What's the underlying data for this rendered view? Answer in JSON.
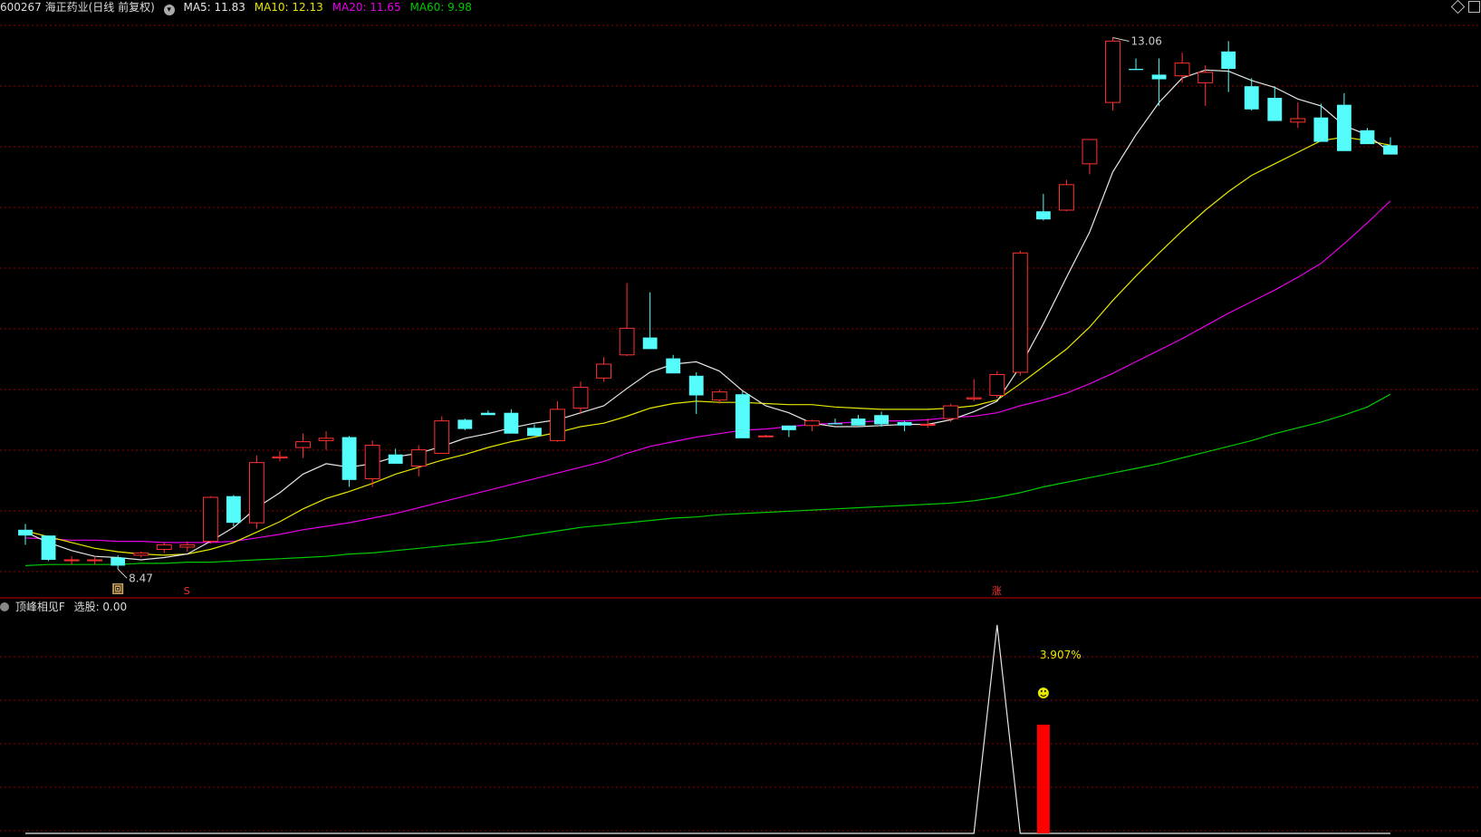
{
  "header": {
    "stock": "600267 海正药业(日线 前复权)",
    "ma5": "MA5: 11.83",
    "ma10": "MA10: 12.13",
    "ma20": "MA20: 11.65",
    "ma60": "MA60: 9.98"
  },
  "indicator": {
    "name": "顶峰相见F",
    "label": "选股: 0.00",
    "percent_label": "3.907%",
    "signal_icon": "smiley-icon"
  },
  "markers": {
    "high_label": "13.06",
    "low_label": "8.47",
    "signal_hui": "回",
    "signal_s": "S",
    "signal_zhang": "涨"
  },
  "colors": {
    "up": "#ff3232",
    "down": "#54fcfc",
    "ma5": "#e6e6e6",
    "ma10": "#e6e600",
    "ma20": "#e600e6",
    "ma60": "#00c800",
    "grid": "#8b0000"
  },
  "chart_data": {
    "type": "candlestick",
    "ohlc": [
      [
        8.81,
        8.86,
        8.68,
        8.76
      ],
      [
        8.76,
        8.73,
        8.54,
        8.55
      ],
      [
        8.55,
        8.58,
        8.51,
        8.55
      ],
      [
        8.55,
        8.58,
        8.51,
        8.55
      ],
      [
        8.57,
        8.59,
        8.47,
        8.5
      ],
      [
        8.59,
        8.62,
        8.57,
        8.61
      ],
      [
        8.64,
        8.7,
        8.61,
        8.68
      ],
      [
        8.66,
        8.71,
        8.62,
        8.68
      ],
      [
        8.71,
        9.1,
        8.69,
        9.09
      ],
      [
        9.1,
        9.11,
        8.84,
        8.87
      ],
      [
        8.87,
        9.45,
        8.82,
        9.39
      ],
      [
        9.43,
        9.49,
        9.4,
        9.44
      ],
      [
        9.52,
        9.64,
        9.43,
        9.57
      ],
      [
        9.58,
        9.66,
        9.5,
        9.6
      ],
      [
        9.61,
        9.62,
        9.18,
        9.24
      ],
      [
        9.25,
        9.58,
        9.18,
        9.54
      ],
      [
        9.46,
        9.51,
        9.45,
        9.38
      ],
      [
        9.36,
        9.54,
        9.27,
        9.5
      ],
      [
        9.47,
        9.79,
        9.47,
        9.75
      ],
      [
        9.76,
        9.77,
        9.67,
        9.68
      ],
      [
        9.82,
        9.84,
        9.81,
        9.8
      ],
      [
        9.82,
        9.85,
        9.79,
        9.64
      ],
      [
        9.69,
        9.72,
        9.64,
        9.62
      ],
      [
        9.58,
        9.92,
        9.57,
        9.85
      ],
      [
        9.86,
        10.09,
        9.81,
        10.04
      ],
      [
        10.12,
        10.3,
        10.09,
        10.24
      ],
      [
        10.32,
        10.94,
        10.31,
        10.55
      ],
      [
        10.47,
        10.86,
        10.38,
        10.37
      ],
      [
        10.29,
        10.32,
        10.24,
        10.16
      ],
      [
        10.14,
        10.17,
        9.81,
        9.97
      ],
      [
        9.93,
        10.02,
        9.9,
        10.0
      ],
      [
        9.98,
        10.01,
        9.63,
        9.6
      ],
      [
        9.62,
        9.63,
        9.61,
        9.62
      ],
      [
        9.71,
        9.71,
        9.61,
        9.67
      ],
      [
        9.71,
        9.76,
        9.66,
        9.75
      ],
      [
        9.73,
        9.77,
        9.72,
        9.72
      ],
      [
        9.77,
        9.8,
        9.71,
        9.71
      ],
      [
        9.8,
        9.83,
        9.7,
        9.72
      ],
      [
        9.74,
        9.75,
        9.66,
        9.71
      ],
      [
        9.72,
        9.77,
        9.69,
        9.72
      ],
      [
        9.77,
        9.9,
        9.74,
        9.88
      ],
      [
        9.94,
        10.11,
        9.92,
        9.95
      ],
      [
        9.97,
        10.18,
        9.95,
        10.15
      ],
      [
        10.17,
        11.22,
        10.14,
        11.2
      ],
      [
        11.56,
        11.71,
        11.48,
        11.49
      ],
      [
        11.57,
        11.83,
        11.56,
        11.79
      ],
      [
        11.97,
        12.18,
        11.88,
        12.18
      ],
      [
        12.5,
        13.06,
        12.43,
        13.03
      ],
      [
        12.79,
        12.88,
        12.78,
        12.78
      ],
      [
        12.74,
        12.88,
        12.47,
        12.7
      ],
      [
        12.73,
        12.93,
        12.67,
        12.84
      ],
      [
        12.67,
        12.82,
        12.47,
        12.76
      ],
      [
        12.94,
        13.03,
        12.59,
        12.79
      ],
      [
        12.64,
        12.71,
        12.43,
        12.44
      ],
      [
        12.54,
        12.64,
        12.37,
        12.34
      ],
      [
        12.33,
        12.5,
        12.28,
        12.36
      ],
      [
        12.37,
        12.49,
        12.16,
        12.16
      ],
      [
        12.48,
        12.58,
        12.2,
        12.08
      ],
      [
        12.26,
        12.28,
        12.14,
        12.14
      ],
      [
        12.13,
        12.2,
        12.07,
        12.05
      ]
    ],
    "ma5": [
      8.79,
      8.7,
      8.63,
      8.58,
      8.57,
      8.55,
      8.57,
      8.6,
      8.71,
      8.83,
      9.0,
      9.13,
      9.29,
      9.38,
      9.35,
      9.38,
      9.44,
      9.47,
      9.53,
      9.6,
      9.64,
      9.69,
      9.73,
      9.76,
      9.82,
      9.88,
      10.03,
      10.17,
      10.24,
      10.26,
      10.18,
      10.01,
      9.88,
      9.82,
      9.73,
      9.7,
      9.7,
      9.71,
      9.72,
      9.72,
      9.76,
      9.83,
      9.92,
      10.22,
      10.59,
      10.99,
      11.38,
      11.9,
      12.22,
      12.5,
      12.71,
      12.78,
      12.77,
      12.69,
      12.63,
      12.53,
      12.47,
      12.3,
      12.22,
      12.07
    ],
    "ma10": [
      8.8,
      8.75,
      8.7,
      8.65,
      8.62,
      8.6,
      8.59,
      8.6,
      8.64,
      8.7,
      8.79,
      8.88,
      8.99,
      9.08,
      9.14,
      9.21,
      9.29,
      9.35,
      9.41,
      9.46,
      9.52,
      9.57,
      9.61,
      9.65,
      9.7,
      9.73,
      9.79,
      9.86,
      9.9,
      9.92,
      9.91,
      9.91,
      9.9,
      9.89,
      9.89,
      9.87,
      9.86,
      9.85,
      9.85,
      9.85,
      9.86,
      9.88,
      9.93,
      10.07,
      10.22,
      10.37,
      10.56,
      10.79,
      11.0,
      11.2,
      11.39,
      11.57,
      11.73,
      11.87,
      11.97,
      12.07,
      12.17,
      12.2,
      12.17,
      12.13
    ],
    "ma20": [
      8.74,
      8.73,
      8.72,
      8.72,
      8.71,
      8.71,
      8.7,
      8.7,
      8.7,
      8.71,
      8.74,
      8.77,
      8.81,
      8.84,
      8.87,
      8.91,
      8.95,
      9.0,
      9.05,
      9.1,
      9.15,
      9.2,
      9.25,
      9.3,
      9.35,
      9.4,
      9.47,
      9.53,
      9.57,
      9.61,
      9.64,
      9.67,
      9.68,
      9.7,
      9.72,
      9.73,
      9.74,
      9.75,
      9.75,
      9.76,
      9.78,
      9.79,
      9.82,
      9.88,
      9.93,
      9.99,
      10.07,
      10.16,
      10.26,
      10.36,
      10.46,
      10.57,
      10.68,
      10.78,
      10.88,
      10.99,
      11.11,
      11.28,
      11.46,
      11.65
    ],
    "ma60": [
      8.5,
      8.51,
      8.51,
      8.51,
      8.51,
      8.52,
      8.52,
      8.53,
      8.53,
      8.54,
      8.55,
      8.56,
      8.57,
      8.58,
      8.6,
      8.61,
      8.63,
      8.65,
      8.67,
      8.69,
      8.71,
      8.74,
      8.77,
      8.8,
      8.83,
      8.85,
      8.87,
      8.89,
      8.91,
      8.92,
      8.94,
      8.95,
      8.96,
      8.97,
      8.98,
      8.99,
      9.0,
      9.01,
      9.02,
      9.03,
      9.04,
      9.06,
      9.09,
      9.13,
      9.18,
      9.22,
      9.26,
      9.3,
      9.34,
      9.38,
      9.43,
      9.48,
      9.53,
      9.58,
      9.64,
      9.69,
      9.74,
      9.8,
      9.87,
      9.98
    ],
    "indicator_line": [
      0,
      0,
      0,
      0,
      0,
      0,
      0,
      0,
      0,
      0,
      0,
      0,
      0,
      0,
      0,
      0,
      0,
      0,
      0,
      0,
      0,
      0,
      0,
      0,
      0,
      0,
      0,
      0,
      0,
      0,
      0,
      0,
      0,
      0,
      0,
      0,
      0,
      0,
      0,
      0,
      0,
      0,
      1.0,
      0,
      0,
      0,
      0,
      0,
      0,
      0,
      0,
      0,
      0,
      0,
      0,
      0,
      0,
      0,
      0,
      0
    ],
    "indicator_bar_index": 44,
    "ylim": [
      8.3,
      13.15
    ],
    "grid": true
  }
}
